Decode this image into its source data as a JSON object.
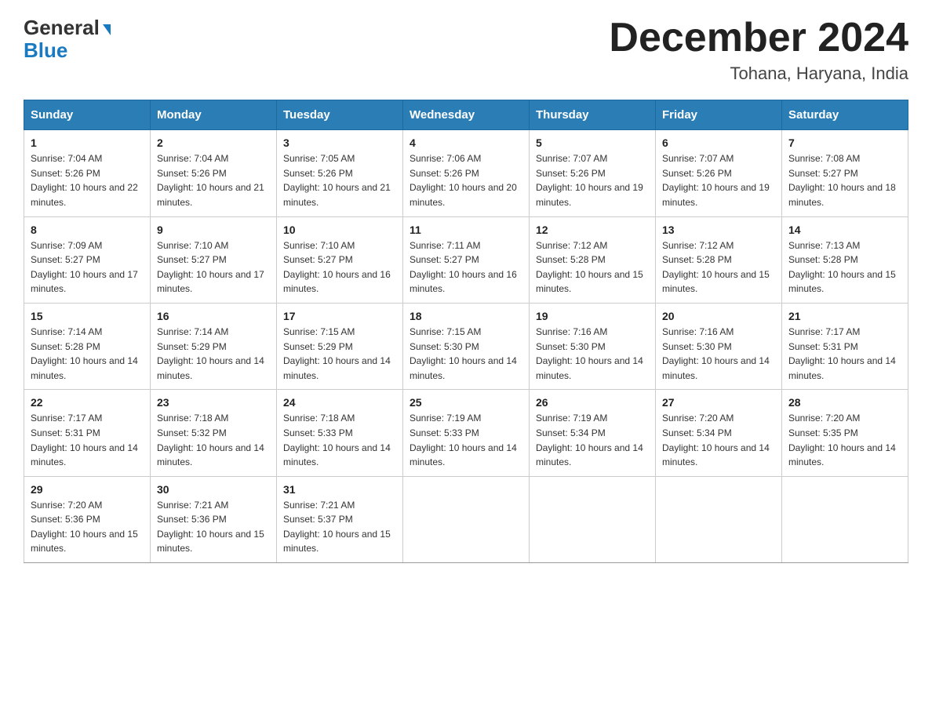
{
  "header": {
    "logo_general": "General",
    "logo_blue": "Blue",
    "month_title": "December 2024",
    "location": "Tohana, Haryana, India"
  },
  "days_of_week": [
    "Sunday",
    "Monday",
    "Tuesday",
    "Wednesday",
    "Thursday",
    "Friday",
    "Saturday"
  ],
  "weeks": [
    [
      {
        "day": "1",
        "sunrise": "7:04 AM",
        "sunset": "5:26 PM",
        "daylight": "10 hours and 22 minutes."
      },
      {
        "day": "2",
        "sunrise": "7:04 AM",
        "sunset": "5:26 PM",
        "daylight": "10 hours and 21 minutes."
      },
      {
        "day": "3",
        "sunrise": "7:05 AM",
        "sunset": "5:26 PM",
        "daylight": "10 hours and 21 minutes."
      },
      {
        "day": "4",
        "sunrise": "7:06 AM",
        "sunset": "5:26 PM",
        "daylight": "10 hours and 20 minutes."
      },
      {
        "day": "5",
        "sunrise": "7:07 AM",
        "sunset": "5:26 PM",
        "daylight": "10 hours and 19 minutes."
      },
      {
        "day": "6",
        "sunrise": "7:07 AM",
        "sunset": "5:26 PM",
        "daylight": "10 hours and 19 minutes."
      },
      {
        "day": "7",
        "sunrise": "7:08 AM",
        "sunset": "5:27 PM",
        "daylight": "10 hours and 18 minutes."
      }
    ],
    [
      {
        "day": "8",
        "sunrise": "7:09 AM",
        "sunset": "5:27 PM",
        "daylight": "10 hours and 17 minutes."
      },
      {
        "day": "9",
        "sunrise": "7:10 AM",
        "sunset": "5:27 PM",
        "daylight": "10 hours and 17 minutes."
      },
      {
        "day": "10",
        "sunrise": "7:10 AM",
        "sunset": "5:27 PM",
        "daylight": "10 hours and 16 minutes."
      },
      {
        "day": "11",
        "sunrise": "7:11 AM",
        "sunset": "5:27 PM",
        "daylight": "10 hours and 16 minutes."
      },
      {
        "day": "12",
        "sunrise": "7:12 AM",
        "sunset": "5:28 PM",
        "daylight": "10 hours and 15 minutes."
      },
      {
        "day": "13",
        "sunrise": "7:12 AM",
        "sunset": "5:28 PM",
        "daylight": "10 hours and 15 minutes."
      },
      {
        "day": "14",
        "sunrise": "7:13 AM",
        "sunset": "5:28 PM",
        "daylight": "10 hours and 15 minutes."
      }
    ],
    [
      {
        "day": "15",
        "sunrise": "7:14 AM",
        "sunset": "5:28 PM",
        "daylight": "10 hours and 14 minutes."
      },
      {
        "day": "16",
        "sunrise": "7:14 AM",
        "sunset": "5:29 PM",
        "daylight": "10 hours and 14 minutes."
      },
      {
        "day": "17",
        "sunrise": "7:15 AM",
        "sunset": "5:29 PM",
        "daylight": "10 hours and 14 minutes."
      },
      {
        "day": "18",
        "sunrise": "7:15 AM",
        "sunset": "5:30 PM",
        "daylight": "10 hours and 14 minutes."
      },
      {
        "day": "19",
        "sunrise": "7:16 AM",
        "sunset": "5:30 PM",
        "daylight": "10 hours and 14 minutes."
      },
      {
        "day": "20",
        "sunrise": "7:16 AM",
        "sunset": "5:30 PM",
        "daylight": "10 hours and 14 minutes."
      },
      {
        "day": "21",
        "sunrise": "7:17 AM",
        "sunset": "5:31 PM",
        "daylight": "10 hours and 14 minutes."
      }
    ],
    [
      {
        "day": "22",
        "sunrise": "7:17 AM",
        "sunset": "5:31 PM",
        "daylight": "10 hours and 14 minutes."
      },
      {
        "day": "23",
        "sunrise": "7:18 AM",
        "sunset": "5:32 PM",
        "daylight": "10 hours and 14 minutes."
      },
      {
        "day": "24",
        "sunrise": "7:18 AM",
        "sunset": "5:33 PM",
        "daylight": "10 hours and 14 minutes."
      },
      {
        "day": "25",
        "sunrise": "7:19 AM",
        "sunset": "5:33 PM",
        "daylight": "10 hours and 14 minutes."
      },
      {
        "day": "26",
        "sunrise": "7:19 AM",
        "sunset": "5:34 PM",
        "daylight": "10 hours and 14 minutes."
      },
      {
        "day": "27",
        "sunrise": "7:20 AM",
        "sunset": "5:34 PM",
        "daylight": "10 hours and 14 minutes."
      },
      {
        "day": "28",
        "sunrise": "7:20 AM",
        "sunset": "5:35 PM",
        "daylight": "10 hours and 14 minutes."
      }
    ],
    [
      {
        "day": "29",
        "sunrise": "7:20 AM",
        "sunset": "5:36 PM",
        "daylight": "10 hours and 15 minutes."
      },
      {
        "day": "30",
        "sunrise": "7:21 AM",
        "sunset": "5:36 PM",
        "daylight": "10 hours and 15 minutes."
      },
      {
        "day": "31",
        "sunrise": "7:21 AM",
        "sunset": "5:37 PM",
        "daylight": "10 hours and 15 minutes."
      },
      null,
      null,
      null,
      null
    ]
  ]
}
